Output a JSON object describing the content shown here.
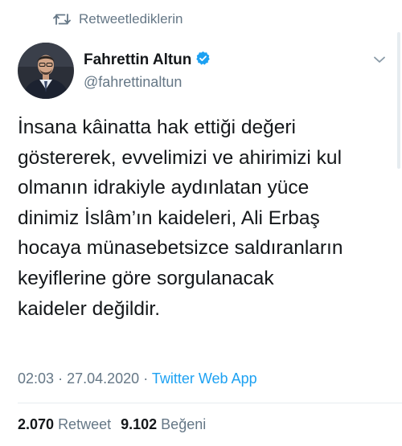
{
  "retweet_notice": {
    "icon": "retweet-icon",
    "label": "Retweetlediklerin"
  },
  "author": {
    "avatar": "avatar",
    "display_name": "Fahrettin Altun",
    "verified_icon": "verified-badge-icon",
    "handle": "@fahrettinaltun"
  },
  "more_menu_icon": "chevron-down-icon",
  "tweet": {
    "text": "İnsana kâinatta hak ettiği değeri\ngöstererek, evvelimizi ve ahirimizi kul\nolmanın idrakiyle aydınlatan yüce\ndinimiz İslâm’ın kaideleri, Ali Erbaş\nhocaya münasebetsizce saldıranların\nkeyiflerine göre sorgulanacak\nkaideler değildir.",
    "time": "02:03",
    "date": "27.04.2020",
    "separator": "·",
    "source": "Twitter Web App"
  },
  "stats": {
    "retweets_count": "2.070",
    "retweets_label": "Retweet",
    "likes_count": "9.102",
    "likes_label": "Beğeni"
  },
  "colors": {
    "text": "#14171a",
    "secondary": "#657786",
    "accent": "#1da1f2",
    "divider": "#e6ecf0"
  }
}
